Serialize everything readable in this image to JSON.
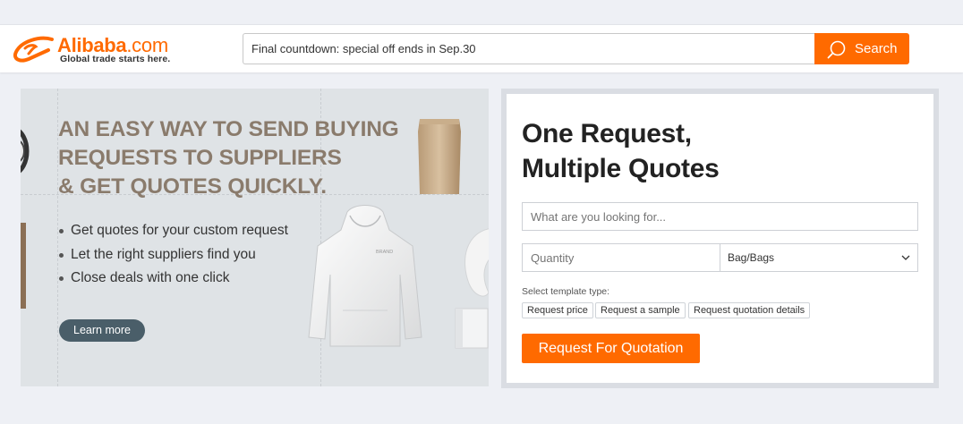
{
  "header": {
    "logo_text": "Alibaba",
    "logo_tld": ".com",
    "logo_tagline": "Global trade starts here.",
    "search_value": "Final countdown: special off ends in Sep.30",
    "search_button": "Search",
    "accent": "#ff6a00"
  },
  "banner": {
    "headline": [
      "AN EASY WAY TO SEND BUYING",
      "REQUESTS TO SUPPLIERS",
      "& GET QUOTES QUICKLY."
    ],
    "bullets": [
      "Get quotes for your custom request",
      "Let the right suppliers find you",
      "Close deals with one click"
    ],
    "hoodie_label": "BRAND",
    "learn_more": "Learn more"
  },
  "rfq": {
    "title_line1": "One Request,",
    "title_line2": "Multiple Quotes",
    "what_placeholder": "What are you looking for...",
    "quantity_placeholder": "Quantity",
    "unit_selected": "Bag/Bags",
    "template_label": "Select template type:",
    "chips": [
      "Request price",
      "Request a sample",
      "Request quotation details"
    ],
    "submit": "Request For Quotation"
  }
}
